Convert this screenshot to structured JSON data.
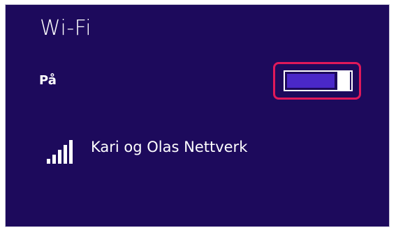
{
  "panel": {
    "title": "Wi-Fi",
    "state_label": "På",
    "toggle": {
      "on": true,
      "highlight_color": "#e0195a",
      "track_color": "#4a28c8"
    },
    "background_color": "#1d0a5c"
  },
  "networks": [
    {
      "name": "Kari og Olas Nettverk",
      "icon": "wifi-signal-icon",
      "signal_bars": 5
    }
  ]
}
